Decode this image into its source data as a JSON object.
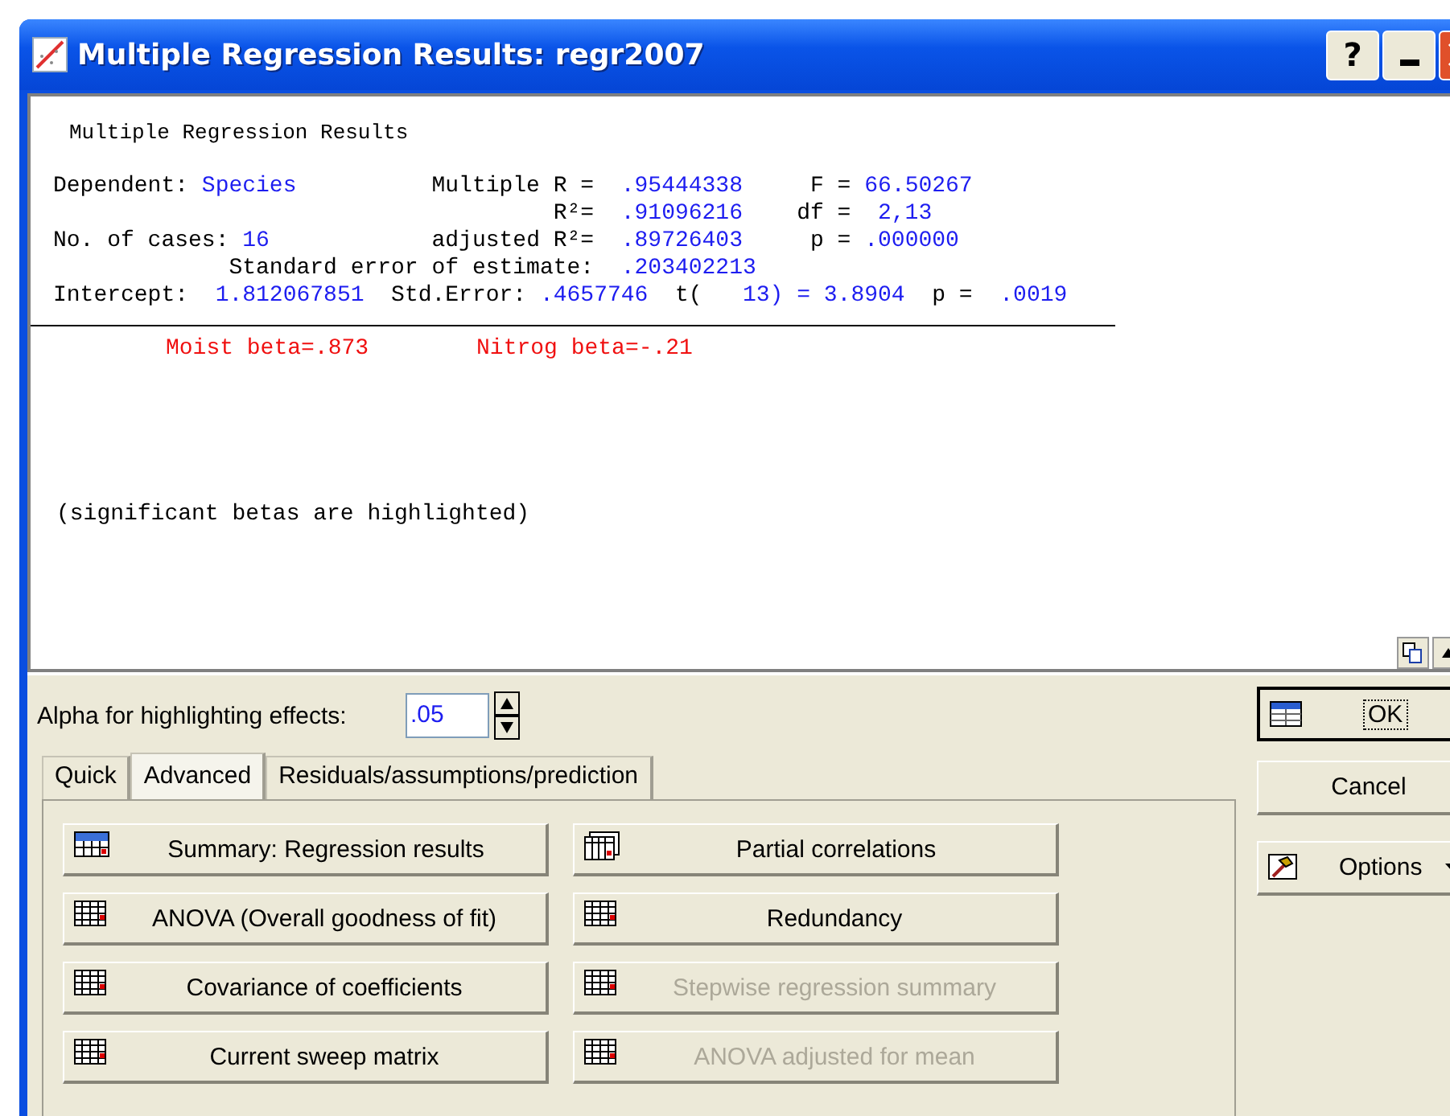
{
  "window": {
    "title": "Multiple Regression Results: regr2007",
    "buttons": [
      "?"
    ]
  },
  "output": {
    "heading": "Multiple Regression Results",
    "lines": [
      {
        "segments": [
          {
            "text": "Dependent: ",
            "kind": "label"
          },
          {
            "text": "Species",
            "kind": "value"
          },
          {
            "text": "          Multiple R =  ",
            "kind": "label"
          },
          {
            "text": ".95444338",
            "kind": "value"
          },
          {
            "text": "     F = ",
            "kind": "label"
          },
          {
            "text": "66.50267",
            "kind": "value"
          }
        ]
      },
      {
        "segments": [
          {
            "text": "                                     R²=  ",
            "kind": "label"
          },
          {
            "text": ".91096216",
            "kind": "value"
          },
          {
            "text": "    df =  ",
            "kind": "label"
          },
          {
            "text": "2,13",
            "kind": "value"
          }
        ]
      },
      {
        "segments": [
          {
            "text": "No. of cases: ",
            "kind": "label"
          },
          {
            "text": "16",
            "kind": "value"
          },
          {
            "text": "            adjusted R²=  ",
            "kind": "label"
          },
          {
            "text": ".89726403",
            "kind": "value"
          },
          {
            "text": "     p = ",
            "kind": "label"
          },
          {
            "text": ".000000",
            "kind": "value"
          }
        ]
      },
      {
        "segments": [
          {
            "text": "             Standard error of estimate:  ",
            "kind": "label"
          },
          {
            "text": ".203402213",
            "kind": "value"
          }
        ]
      },
      {
        "segments": [
          {
            "text": "Intercept:  ",
            "kind": "label"
          },
          {
            "text": "1.812067851",
            "kind": "value"
          },
          {
            "text": "  Std.Error: ",
            "kind": "label"
          },
          {
            "text": ".4657746",
            "kind": "value"
          },
          {
            "text": "  t(   ",
            "kind": "label"
          },
          {
            "text": "13) = 3.8904",
            "kind": "value"
          },
          {
            "text": "  p =  ",
            "kind": "label"
          },
          {
            "text": ".0019",
            "kind": "value"
          }
        ]
      }
    ],
    "betas": [
      {
        "text": "Moist beta=.873",
        "kind": "beta"
      },
      {
        "text": "Nitrog beta=-.21",
        "kind": "beta"
      }
    ],
    "note": "(significant betas are highlighted)"
  },
  "alpha": {
    "label": "Alpha for highlighting effects:",
    "value": ".05"
  },
  "tabs": [
    {
      "label": "Quick",
      "selected": false
    },
    {
      "label": "Advanced",
      "selected": true
    },
    {
      "label": "Residuals/assumptions/prediction",
      "selected": false
    }
  ],
  "buttons": [
    {
      "label": "Summary:  Regression results",
      "kind": "summary",
      "disabled": false
    },
    {
      "label": "Partial correlations",
      "kind": "stack",
      "disabled": false
    },
    {
      "label": "ANOVA (Overall goodness of fit)",
      "kind": "grid",
      "disabled": false
    },
    {
      "label": "Redundancy",
      "kind": "grid",
      "disabled": false
    },
    {
      "label": "Covariance of coefficients",
      "kind": "grid",
      "disabled": false
    },
    {
      "label": "Stepwise regression summary",
      "kind": "grid",
      "disabled": true
    },
    {
      "label": "Current sweep matrix",
      "kind": "grid",
      "disabled": false
    },
    {
      "label": "ANOVA adjusted for mean",
      "kind": "grid",
      "disabled": true
    }
  ],
  "side_buttons": [
    {
      "label": "OK",
      "kind": "ok"
    },
    {
      "label": "Cancel",
      "kind": "plain"
    },
    {
      "label": "Options",
      "kind": "options"
    }
  ]
}
